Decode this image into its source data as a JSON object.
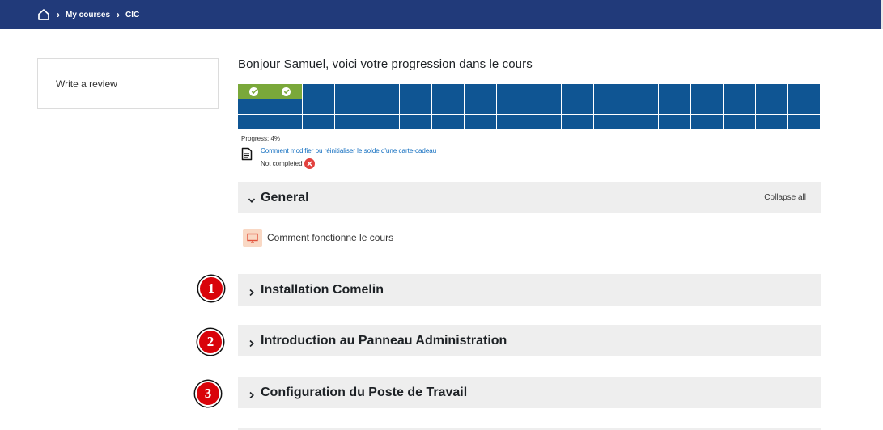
{
  "breadcrumb": {
    "home_icon": "home-icon",
    "items": [
      "My courses",
      "CIC"
    ]
  },
  "sidebar": {
    "review_label": "Write a review"
  },
  "main": {
    "greeting": "Bonjour Samuel, voici votre progression dans le cours",
    "progress": {
      "grid_columns": 18,
      "grid_rows": 3,
      "completed_cells": 2,
      "percent": 4,
      "label": "Progress: 4%",
      "colors": {
        "completed": "#7aa83a",
        "pending": "#0f5593"
      }
    },
    "activity": {
      "icon": "document-icon",
      "link": "Comment modifier ou réinitialiser le solde d'une carte-cadeau",
      "status": "Not completed",
      "status_icon": "close-circle-icon"
    },
    "general": {
      "title": "General",
      "collapse_label": "Collapse all",
      "lesson": {
        "icon": "presentation-icon",
        "label": "Comment fonctionne le cours"
      }
    },
    "sections": [
      {
        "badge": "1",
        "title": "Installation Comelin"
      },
      {
        "badge": "2",
        "title": "Introduction au Panneau Administration"
      },
      {
        "badge": "3",
        "title": "Configuration du Poste de Travail"
      }
    ]
  },
  "colors": {
    "topbar": "#213a7a",
    "badge": "#d9030a",
    "section_bg": "#eeeeee",
    "link": "#0f6cbf"
  }
}
